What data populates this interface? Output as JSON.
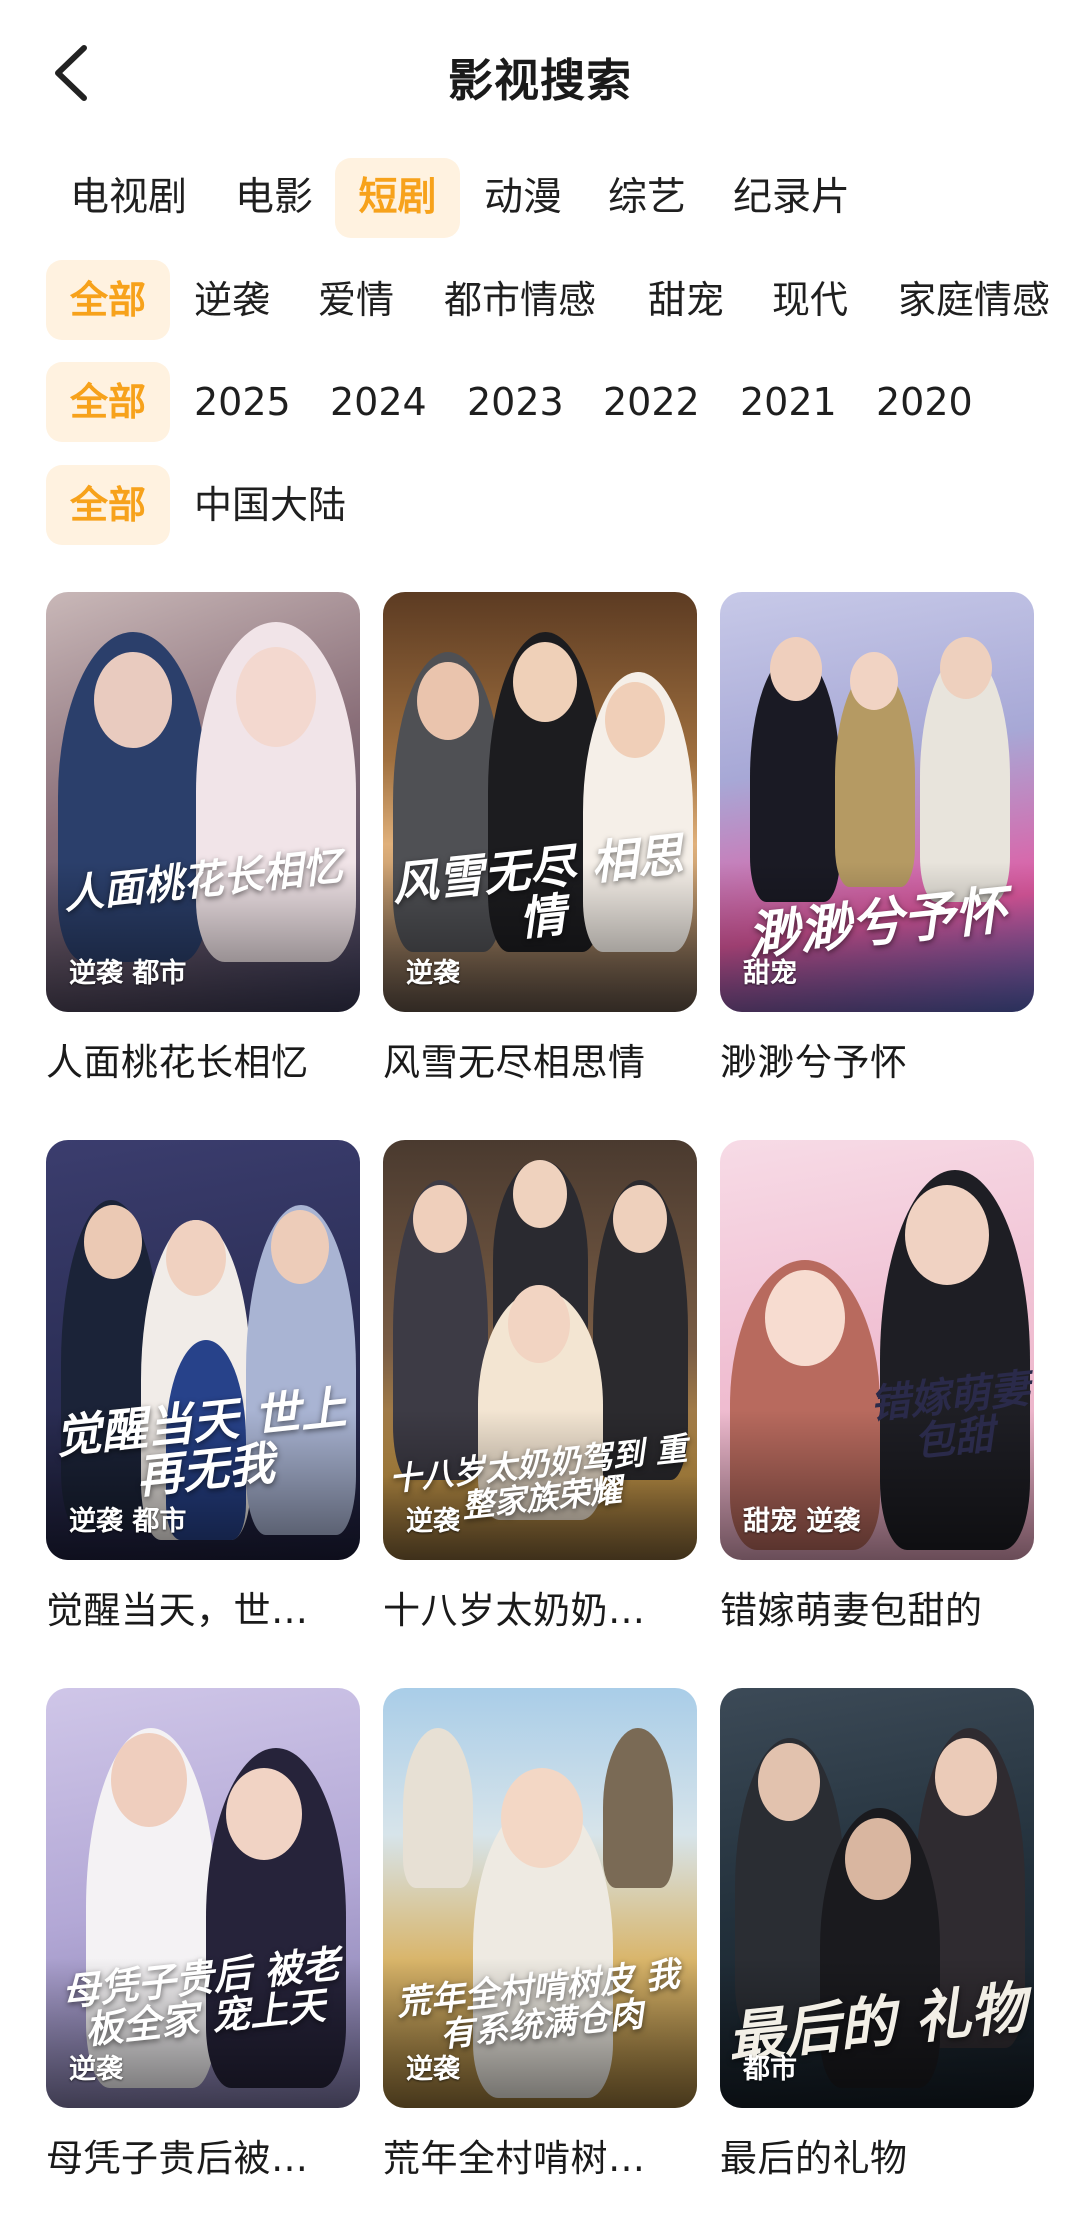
{
  "header": {
    "title": "影视搜索"
  },
  "categories": [
    {
      "label": "电视剧",
      "selected": false
    },
    {
      "label": "电影",
      "selected": false
    },
    {
      "label": "短剧",
      "selected": true
    },
    {
      "label": "动漫",
      "selected": false
    },
    {
      "label": "综艺",
      "selected": false
    },
    {
      "label": "纪录片",
      "selected": false
    }
  ],
  "genres": [
    "全部",
    "逆袭",
    "爱情",
    "都市情感",
    "甜宠",
    "现代",
    "家庭情感"
  ],
  "years": [
    "全部",
    "2025",
    "2024",
    "2023",
    "2022",
    "2021",
    "2020"
  ],
  "regions": [
    "全部",
    "中国大陆"
  ],
  "accent_color": "#f7a21b",
  "selected_chip_bg": "#fff2e0",
  "items": [
    {
      "title": "人面桃花长相忆",
      "tags": "逆袭 都市",
      "poster_text": "人面桃花长相忆"
    },
    {
      "title": "风雪无尽相思情",
      "tags": "逆袭",
      "poster_text": "风雪无尽 相思情"
    },
    {
      "title": "渺渺兮予怀",
      "tags": "甜宠",
      "poster_text": "渺渺兮予怀"
    },
    {
      "title": "觉醒当天，世…",
      "tags": "逆袭 都市",
      "poster_text": "觉醒当天 世上再无我"
    },
    {
      "title": "十八岁太奶奶…",
      "tags": "逆袭",
      "poster_text": "十八岁太奶奶驾到 重整家族荣耀"
    },
    {
      "title": "错嫁萌妻包甜的",
      "tags": "甜宠 逆袭",
      "poster_text": "错嫁萌妻包甜"
    },
    {
      "title": "母凭子贵后被…",
      "tags": "逆袭",
      "poster_text": "母凭子贵后 被老板全家 宠上天"
    },
    {
      "title": "荒年全村啃树…",
      "tags": "逆袭",
      "poster_text": "荒年全村啃树皮 我有系统满仓肉"
    },
    {
      "title": "最后的礼物",
      "tags": "都市",
      "poster_text": "最后的 礼物"
    }
  ]
}
